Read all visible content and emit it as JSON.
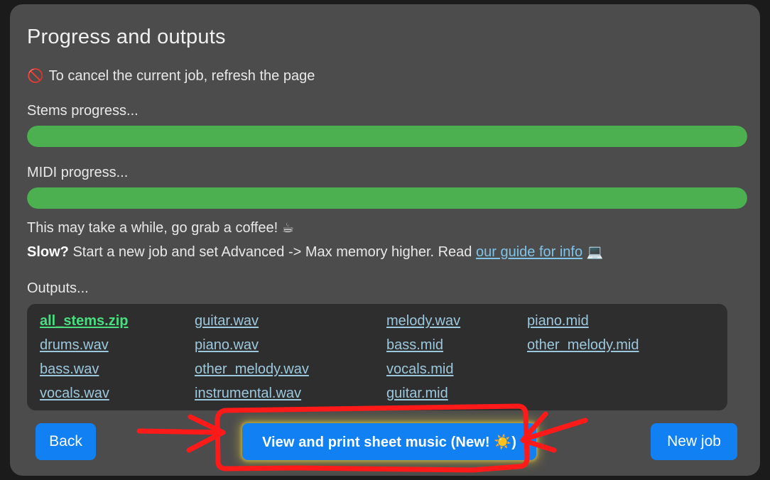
{
  "window": {
    "background": "#1b1b1b",
    "card_background": "#4c4c4c"
  },
  "header": {
    "title": "Progress and outputs"
  },
  "notice": {
    "icon": "no-entry-icon",
    "icon_glyph": "🚫",
    "text": "To cancel the current job, refresh the page"
  },
  "progress": {
    "stems": {
      "label": "Stems progress...",
      "percent": 100,
      "color": "#4caf50"
    },
    "midi": {
      "label": "MIDI progress...",
      "percent": 100,
      "color": "#4caf50"
    }
  },
  "notes": {
    "wait_text": "This may take a while, go grab a coffee!",
    "coffee_emoji": "☕",
    "slow_bold": "Slow?",
    "slow_text_before": " Start a new job and set Advanced -> Max memory higher. Read ",
    "slow_link": "our guide for info",
    "laptop_emoji": "💻",
    "link_color": "#7fc4e8"
  },
  "outputs": {
    "label": "Outputs...",
    "items": [
      {
        "name": "all_stems.zip",
        "style": "primary"
      },
      {
        "name": "guitar.wav",
        "style": "link"
      },
      {
        "name": "melody.wav",
        "style": "link"
      },
      {
        "name": "piano.mid",
        "style": "link"
      },
      {
        "name": "drums.wav",
        "style": "link"
      },
      {
        "name": "piano.wav",
        "style": "link"
      },
      {
        "name": "bass.mid",
        "style": "link"
      },
      {
        "name": "other_melody.mid",
        "style": "link"
      },
      {
        "name": "bass.wav",
        "style": "link"
      },
      {
        "name": "other_melody.wav",
        "style": "link"
      },
      {
        "name": "vocals.mid",
        "style": "link"
      },
      {
        "name": "",
        "style": "blank"
      },
      {
        "name": "vocals.wav",
        "style": "link"
      },
      {
        "name": "instrumental.wav",
        "style": "link"
      },
      {
        "name": "guitar.mid",
        "style": "link"
      },
      {
        "name": "",
        "style": "blank"
      }
    ],
    "link_color": "#9cc8dd",
    "primary_color": "#4ade80"
  },
  "footer": {
    "back_label": "Back",
    "sheet_music_label": "View and print sheet music (New! ☀️)",
    "new_job_label": "New job",
    "button_color": "#1180f3"
  },
  "annotations": {
    "color": "#ff1a1a",
    "highlight_target": "sheet-music-button",
    "shapes": [
      "left-arrow-pointing-right",
      "right-arrow-pointing-left",
      "hand-drawn-rounded-box"
    ]
  }
}
